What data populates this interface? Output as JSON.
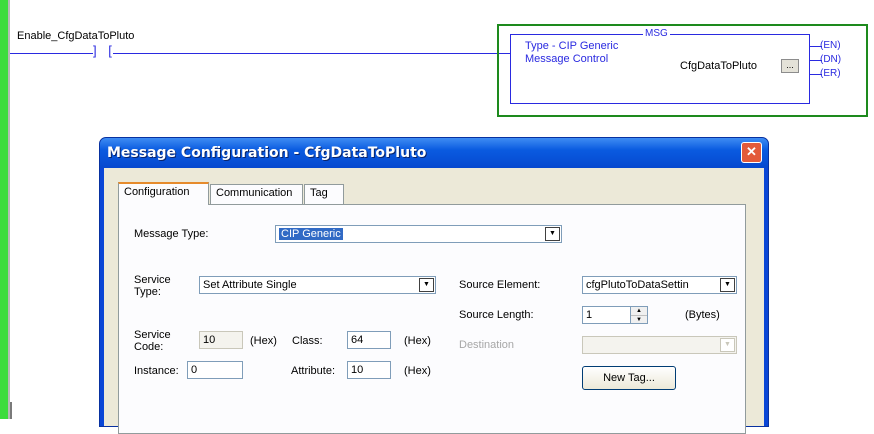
{
  "ladder": {
    "contact_tag": "Enable_CfgDataToPluto",
    "msg_block": {
      "title": "MSG",
      "type_line1": "Type - CIP Generic",
      "type_line2": "Message Control",
      "control_tag": "CfgDataToPluto",
      "ellipsis": "...",
      "outputs": [
        "(EN)",
        "(DN)",
        "(ER)"
      ]
    }
  },
  "dialog": {
    "title": "Message Configuration - CfgDataToPluto",
    "close_glyph": "✕",
    "tabs": [
      "Configuration",
      "Communication",
      "Tag"
    ],
    "active_tab": "Configuration",
    "form": {
      "message_type_label": "Message Type:",
      "message_type_value": "CIP Generic",
      "service_type_label_1": "Service",
      "service_type_label_2": "Type:",
      "service_type_value": "Set Attribute Single",
      "service_code_label_1": "Service",
      "service_code_label_2": "Code:",
      "service_code_value": "10",
      "hex_label": "(Hex)",
      "class_label": "Class:",
      "class_value": "64",
      "instance_label": "Instance:",
      "instance_value": "0",
      "attribute_label": "Attribute:",
      "attribute_value": "10",
      "source_element_label": "Source Element:",
      "source_element_value": "cfgPlutoToDataSettin",
      "source_length_label": "Source Length:",
      "source_length_value": "1",
      "bytes_label": "(Bytes)",
      "destination_label": "Destination",
      "destination_value": "",
      "new_tag_label": "New Tag..."
    }
  },
  "icons": {
    "dropdown": "▼",
    "spin_up": "▲",
    "spin_down": "▼"
  },
  "colors": {
    "rail": "#3ddc3d",
    "rung": "#2a2ae0",
    "titlebar": "#0a5be0",
    "selection": "#316ac5"
  }
}
